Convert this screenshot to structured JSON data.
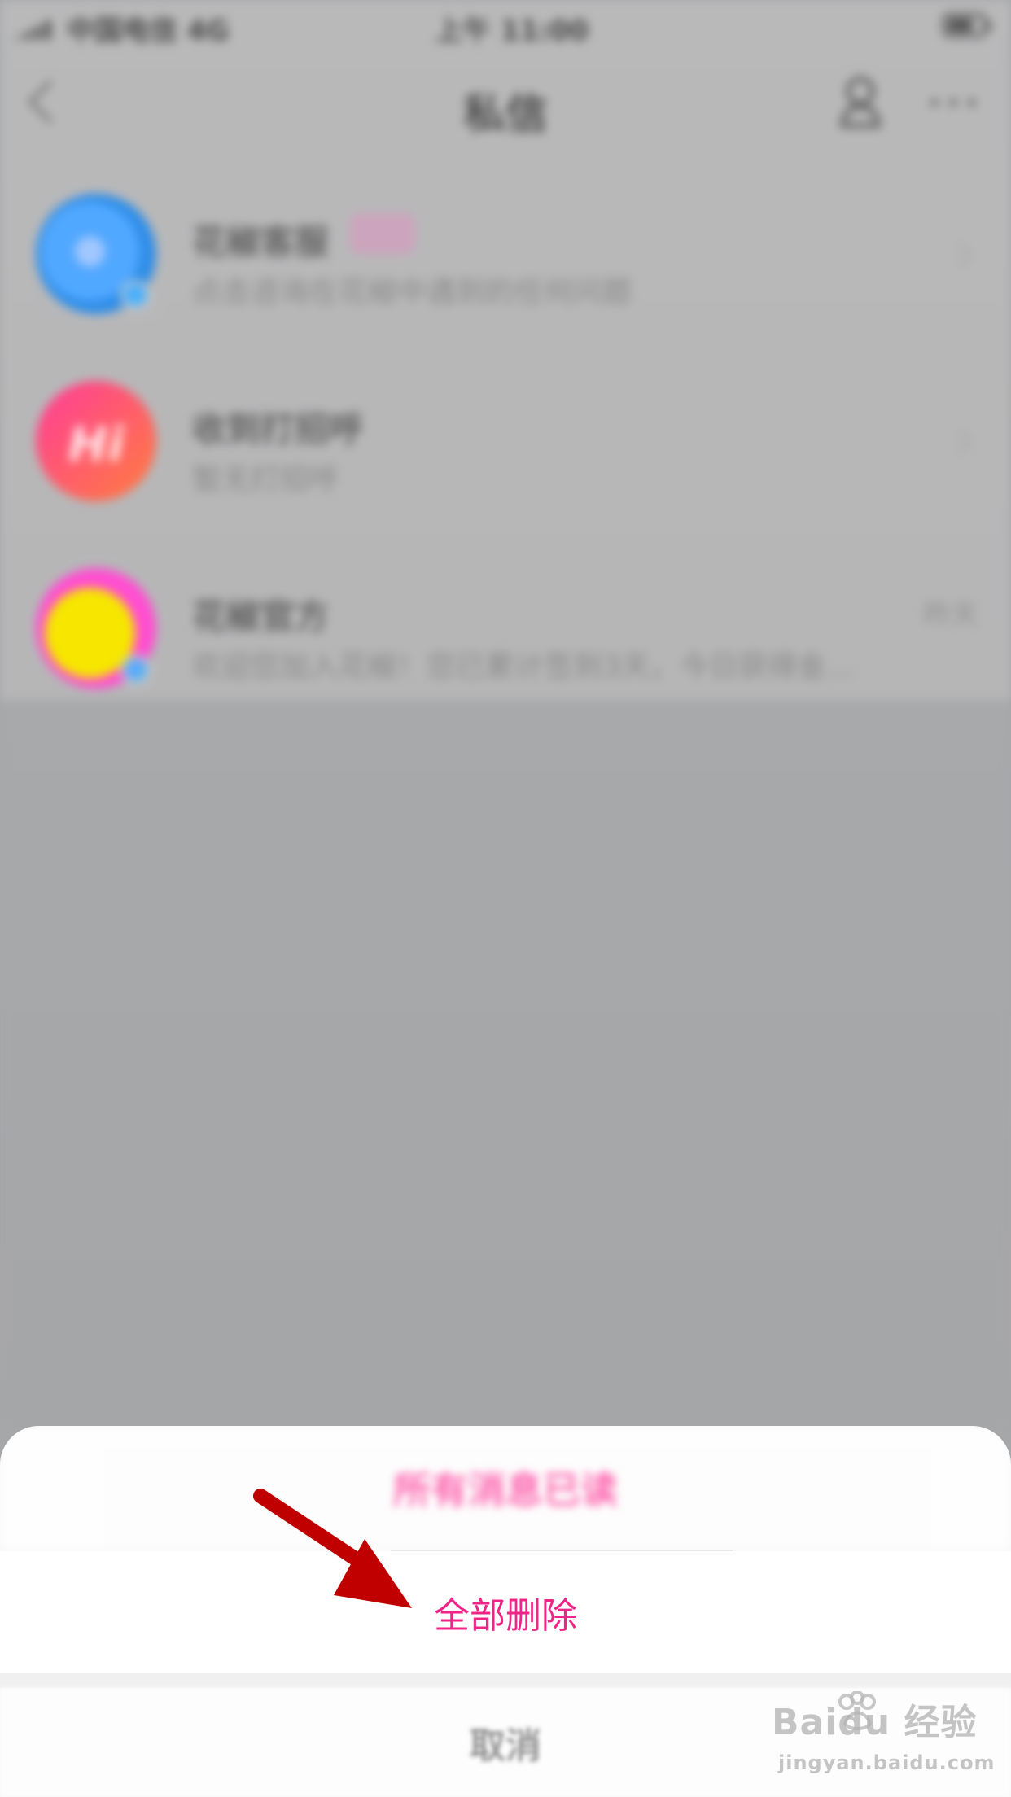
{
  "status_bar": {
    "carrier": "中国电信 4G",
    "time": "上午 11:00"
  },
  "nav": {
    "title": "私信"
  },
  "messages": [
    {
      "name": "花椒客服",
      "preview": "点击咨询在花椒中遇到的任何问题",
      "time": ""
    },
    {
      "name": "收到打招呼",
      "preview": "暂无打招呼",
      "time": ""
    },
    {
      "name": "花椒官方",
      "preview": "欢迎您加入花椒！您已累计签到3天，今日获得金...",
      "time": "昨天"
    }
  ],
  "avatar_text": "Hi",
  "action_sheet": {
    "mark_read": "所有消息已读",
    "delete_all": "全部删除",
    "cancel": "取消"
  },
  "watermark": {
    "main": "Baidu 经验",
    "sub": "jingyan.baidu.com"
  },
  "colors": {
    "accent": "#f02386",
    "arrow": "#c00000",
    "overlay": "#a7a8aa"
  }
}
